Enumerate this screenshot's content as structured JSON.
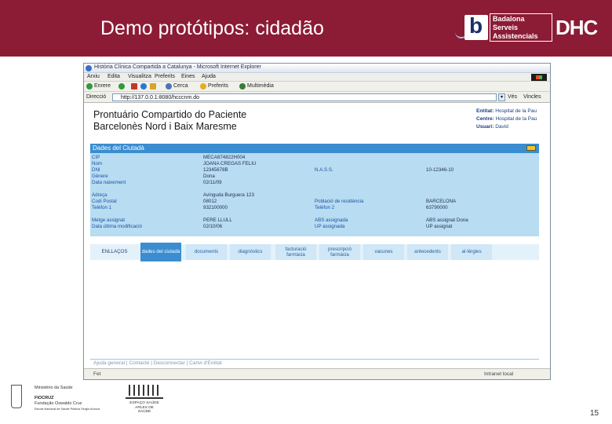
{
  "slide": {
    "title": "Demo protótipos: cidadão",
    "page_number": "15",
    "colors": {
      "header_bg": "#8c1b35",
      "panel_bg": "#b8dcf1",
      "panel_header": "#3a8dd0"
    }
  },
  "logos": {
    "bsa_letter": "b",
    "bsa_lines": [
      "Badalona",
      "Serveis",
      "Assistencials"
    ],
    "dhc": "DHC",
    "ministry_lines": [
      "Ministério da Saúde",
      "FIOCRUZ",
      "Fundação Oswaldo Cruz",
      "Escola Nacional de Saúde Pública Sergio Arouca"
    ],
    "fiocruz_lines": [
      "ESPAÇO SAÚDE",
      "ARLES DE",
      "SAÚDE"
    ]
  },
  "browser": {
    "window_title": "Història Clínica Compartida a Catalunya - Microsoft Internet Explorer",
    "menu": [
      "Arxiu",
      "Edita",
      "Visualitza",
      "Preferits",
      "Eines",
      "Ajuda"
    ],
    "toolbar": {
      "back": "Enrere",
      "search": "Cerca",
      "favorites": "Preferits",
      "multimedia": "Multimèdia"
    },
    "address_label": "Direcció",
    "address_value": "http://137.0.0.1:8080/hcccnm.do",
    "go_label": "Vés",
    "links_label": "Vincles",
    "status_text": "Fet",
    "zone_text": "Intranet local"
  },
  "page": {
    "title_line1": "Prontuário Compartido do Paciente",
    "title_line2": "Barcelonès Nord i Baix Maresme",
    "meta": [
      {
        "label": "Entitat:",
        "value": "Hospital de la Pau"
      },
      {
        "label": "Centre:",
        "value": "Hospital de la Pau"
      },
      {
        "label": "Usuari:",
        "value": "David"
      }
    ],
    "panel_title": "Dades del Ciutadà",
    "rows": [
      {
        "label": "CIP",
        "value": "MECA874822H004"
      },
      {
        "label": "Nom",
        "value": "JOANA CREGAS FELIU"
      },
      {
        "label": "DNI",
        "value": "12345678B"
      },
      {
        "label": "Gènere",
        "value": "Dona"
      },
      {
        "label": "Data naixement",
        "value": "02/11/09"
      }
    ],
    "nass": {
      "label": "N.A.S.S.",
      "value": "10-12346-10"
    },
    "address_rows": [
      {
        "label": "Adreça",
        "value": "Avinguda Burguera 123"
      },
      {
        "label": "Codi Postal",
        "value": "08012"
      },
      {
        "label": "Telèfon 1",
        "value": "932100000"
      }
    ],
    "residence": [
      {
        "label": "Població de residència",
        "value": "BARCELONA"
      },
      {
        "label": "Telèfon 2",
        "value": "63790000"
      }
    ],
    "doctor_rows": [
      {
        "label": "Metge assignat",
        "value": "PERE LLULL"
      },
      {
        "label": "Data última modificació",
        "value": "02/10/06"
      }
    ],
    "abs_rows": [
      {
        "label": "ABS assignada",
        "value": "ABS assignat Dona"
      },
      {
        "label": "UP assignada",
        "value": "UP assignat"
      }
    ],
    "tabs": [
      "ENLLAÇOS",
      "dades del ciutadà",
      "documents",
      "diagnòstics",
      "facturació farmàcia",
      "prescripció farmàcia",
      "vacunes",
      "antecedents",
      "al·lèrgies"
    ],
    "footer_links": "Ajuda general  |  Contacte  |  Desconnectar  |  Canvi d'Entitat"
  }
}
